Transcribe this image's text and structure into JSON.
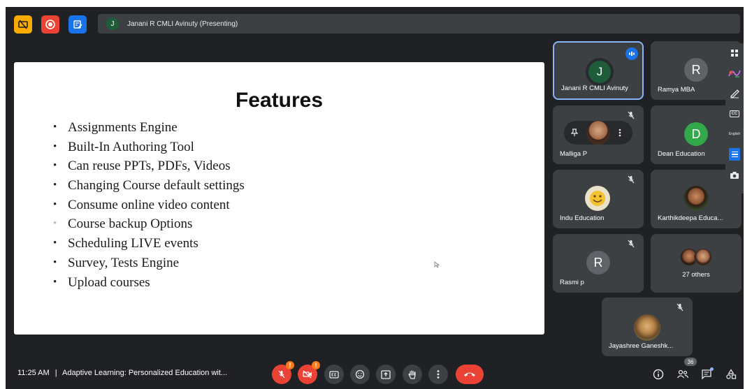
{
  "presenting_bar": {
    "initial": "J",
    "text": "Janani R CMLI Avinuty (Presenting)"
  },
  "slide": {
    "title": "Features",
    "bullets": [
      "Assignments Engine",
      "Built-In Authoring Tool",
      "Can reuse PPTs, PDFs, Videos",
      "Changing Course default settings",
      "Consume online video content",
      "Course backup Options",
      "Scheduling LIVE events",
      "Survey, Tests Engine",
      "Upload courses"
    ]
  },
  "participants": [
    {
      "name": "Janani R CMLI Avinuty",
      "initial": "J",
      "color": "#1e5c3a",
      "speaking": true
    },
    {
      "name": "Ramya MBA",
      "initial": "R",
      "color": "#5f6368"
    },
    {
      "name": "Malliga P",
      "muted": true,
      "photo": true
    },
    {
      "name": "Dean Education",
      "initial": "D",
      "color": "#33a84a"
    },
    {
      "name": "Indu Education",
      "muted": true,
      "photo": true
    },
    {
      "name": "Karthikdeepa Educa...",
      "photo": true
    },
    {
      "name": "Rasmi p",
      "initial": "R",
      "color": "#5f6368",
      "muted": true
    },
    {
      "name": "27 others"
    },
    {
      "name": "Jayashree Ganeshk...",
      "muted": true,
      "photo": true
    }
  ],
  "side_tools": {
    "cc_label": "CC",
    "language": "English"
  },
  "bottom": {
    "time": "11:25 AM",
    "separator": "|",
    "meeting_title": "Adaptive Learning: Personalized Education wit...",
    "mic_badge": "!",
    "cam_badge": "!",
    "people_count": "36"
  },
  "colors": {
    "background": "#202124",
    "tile": "#3c4043",
    "accent": "#8ab4f8",
    "end_call": "#ea4335",
    "warning": "#fa7b17"
  }
}
